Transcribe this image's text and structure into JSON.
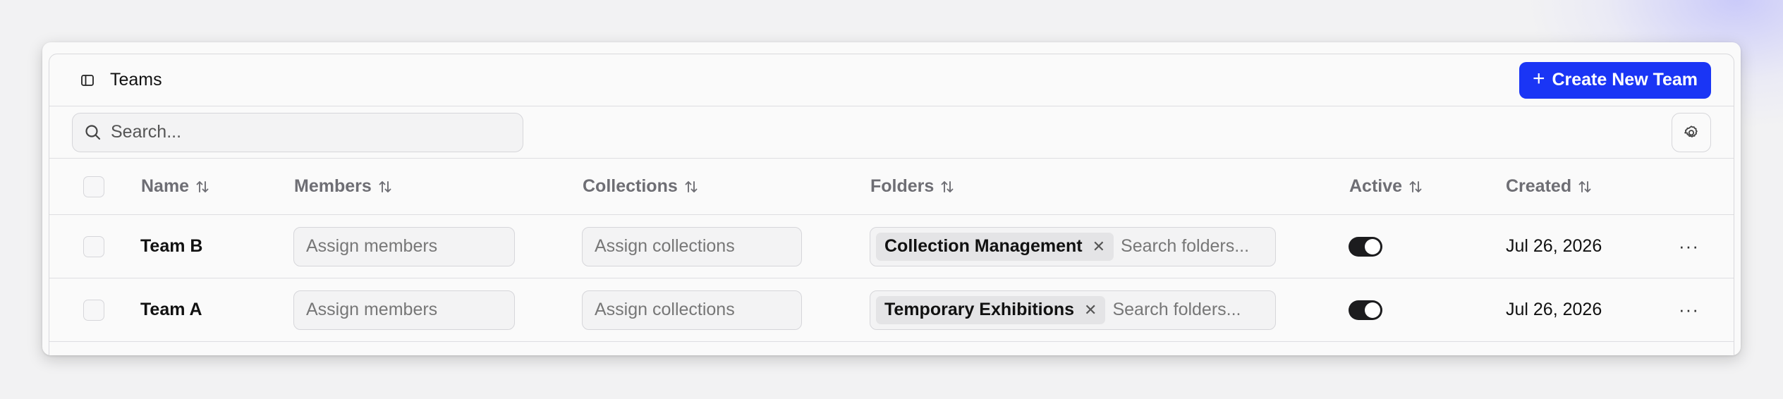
{
  "header": {
    "title": "Teams",
    "create_button_label": "Create New Team"
  },
  "toolbar": {
    "search_placeholder": "Search..."
  },
  "table": {
    "columns": [
      "Name",
      "Members",
      "Collections",
      "Folders",
      "Active",
      "Created"
    ],
    "rows": [
      {
        "name": "Team B",
        "members_placeholder": "Assign members",
        "collections_placeholder": "Assign collections",
        "folder_chip": "Collection Management",
        "folders_placeholder": "Search folders...",
        "active": true,
        "created": "Jul 26, 2026"
      },
      {
        "name": "Team A",
        "members_placeholder": "Assign members",
        "collections_placeholder": "Assign collections",
        "folder_chip": "Temporary Exhibitions",
        "folders_placeholder": "Search folders...",
        "active": true,
        "created": "Jul 26, 2026"
      }
    ]
  },
  "icons": {
    "sidebar": "sidebar-toggle-icon",
    "search": "search-icon",
    "settings": "gear-icon",
    "sort": "sort-arrows-icon",
    "remove": "close-icon",
    "row_actions": "more-horizontal-icon"
  },
  "colors": {
    "accent": "#1a35f5",
    "toggle_on": "#1c1c1e"
  }
}
